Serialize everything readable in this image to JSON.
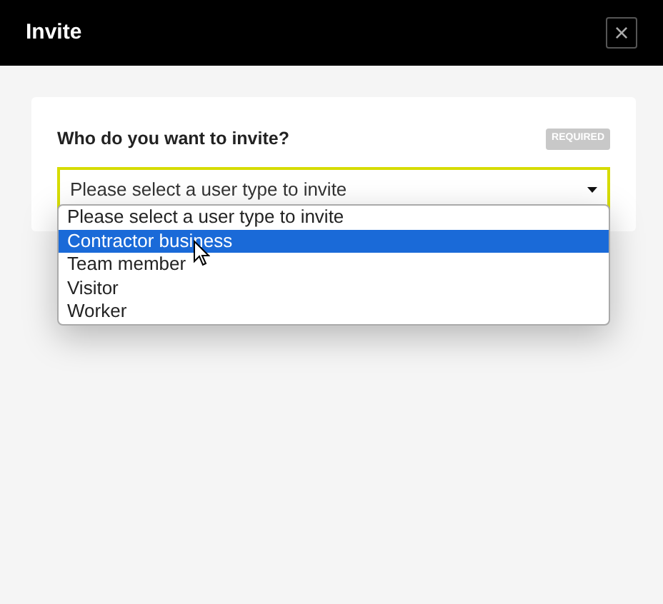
{
  "window": {
    "title": "Invite",
    "close": "×"
  },
  "field": {
    "label": "Who do you want to invite?",
    "badge": "REQUIRED",
    "value": "Please select a user type to invite",
    "expanded": true
  },
  "options": [
    {
      "label": "Please select a user type to invite",
      "selected": false
    },
    {
      "label": "Contractor business",
      "selected": true
    },
    {
      "label": "Team member",
      "selected": false
    },
    {
      "label": "Visitor",
      "selected": false
    },
    {
      "label": "Worker",
      "selected": false
    }
  ]
}
